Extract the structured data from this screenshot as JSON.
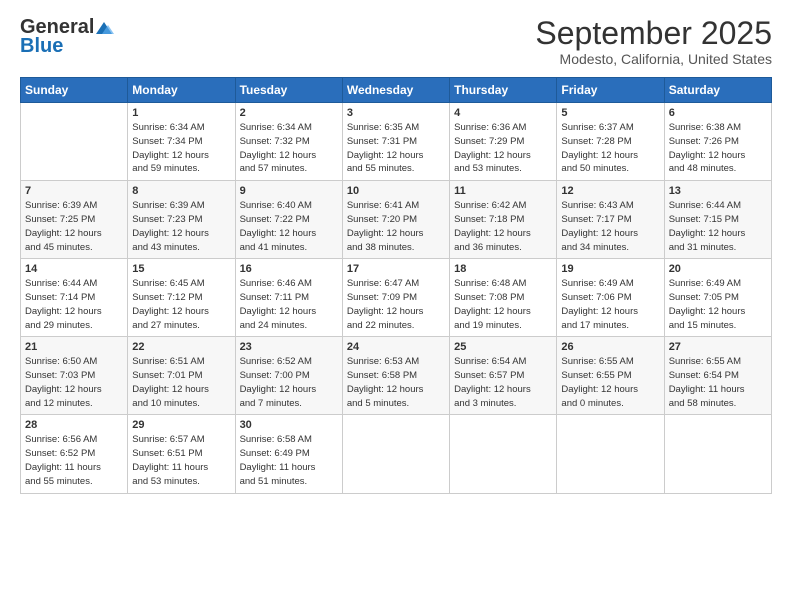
{
  "logo": {
    "general": "General",
    "blue": "Blue"
  },
  "header": {
    "title": "September 2025",
    "subtitle": "Modesto, California, United States"
  },
  "calendar": {
    "days": [
      "Sunday",
      "Monday",
      "Tuesday",
      "Wednesday",
      "Thursday",
      "Friday",
      "Saturday"
    ]
  },
  "weeks": [
    [
      {
        "day": "",
        "info": ""
      },
      {
        "day": "1",
        "info": "Sunrise: 6:34 AM\nSunset: 7:34 PM\nDaylight: 12 hours\nand 59 minutes."
      },
      {
        "day": "2",
        "info": "Sunrise: 6:34 AM\nSunset: 7:32 PM\nDaylight: 12 hours\nand 57 minutes."
      },
      {
        "day": "3",
        "info": "Sunrise: 6:35 AM\nSunset: 7:31 PM\nDaylight: 12 hours\nand 55 minutes."
      },
      {
        "day": "4",
        "info": "Sunrise: 6:36 AM\nSunset: 7:29 PM\nDaylight: 12 hours\nand 53 minutes."
      },
      {
        "day": "5",
        "info": "Sunrise: 6:37 AM\nSunset: 7:28 PM\nDaylight: 12 hours\nand 50 minutes."
      },
      {
        "day": "6",
        "info": "Sunrise: 6:38 AM\nSunset: 7:26 PM\nDaylight: 12 hours\nand 48 minutes."
      }
    ],
    [
      {
        "day": "7",
        "info": "Sunrise: 6:39 AM\nSunset: 7:25 PM\nDaylight: 12 hours\nand 45 minutes."
      },
      {
        "day": "8",
        "info": "Sunrise: 6:39 AM\nSunset: 7:23 PM\nDaylight: 12 hours\nand 43 minutes."
      },
      {
        "day": "9",
        "info": "Sunrise: 6:40 AM\nSunset: 7:22 PM\nDaylight: 12 hours\nand 41 minutes."
      },
      {
        "day": "10",
        "info": "Sunrise: 6:41 AM\nSunset: 7:20 PM\nDaylight: 12 hours\nand 38 minutes."
      },
      {
        "day": "11",
        "info": "Sunrise: 6:42 AM\nSunset: 7:18 PM\nDaylight: 12 hours\nand 36 minutes."
      },
      {
        "day": "12",
        "info": "Sunrise: 6:43 AM\nSunset: 7:17 PM\nDaylight: 12 hours\nand 34 minutes."
      },
      {
        "day": "13",
        "info": "Sunrise: 6:44 AM\nSunset: 7:15 PM\nDaylight: 12 hours\nand 31 minutes."
      }
    ],
    [
      {
        "day": "14",
        "info": "Sunrise: 6:44 AM\nSunset: 7:14 PM\nDaylight: 12 hours\nand 29 minutes."
      },
      {
        "day": "15",
        "info": "Sunrise: 6:45 AM\nSunset: 7:12 PM\nDaylight: 12 hours\nand 27 minutes."
      },
      {
        "day": "16",
        "info": "Sunrise: 6:46 AM\nSunset: 7:11 PM\nDaylight: 12 hours\nand 24 minutes."
      },
      {
        "day": "17",
        "info": "Sunrise: 6:47 AM\nSunset: 7:09 PM\nDaylight: 12 hours\nand 22 minutes."
      },
      {
        "day": "18",
        "info": "Sunrise: 6:48 AM\nSunset: 7:08 PM\nDaylight: 12 hours\nand 19 minutes."
      },
      {
        "day": "19",
        "info": "Sunrise: 6:49 AM\nSunset: 7:06 PM\nDaylight: 12 hours\nand 17 minutes."
      },
      {
        "day": "20",
        "info": "Sunrise: 6:49 AM\nSunset: 7:05 PM\nDaylight: 12 hours\nand 15 minutes."
      }
    ],
    [
      {
        "day": "21",
        "info": "Sunrise: 6:50 AM\nSunset: 7:03 PM\nDaylight: 12 hours\nand 12 minutes."
      },
      {
        "day": "22",
        "info": "Sunrise: 6:51 AM\nSunset: 7:01 PM\nDaylight: 12 hours\nand 10 minutes."
      },
      {
        "day": "23",
        "info": "Sunrise: 6:52 AM\nSunset: 7:00 PM\nDaylight: 12 hours\nand 7 minutes."
      },
      {
        "day": "24",
        "info": "Sunrise: 6:53 AM\nSunset: 6:58 PM\nDaylight: 12 hours\nand 5 minutes."
      },
      {
        "day": "25",
        "info": "Sunrise: 6:54 AM\nSunset: 6:57 PM\nDaylight: 12 hours\nand 3 minutes."
      },
      {
        "day": "26",
        "info": "Sunrise: 6:55 AM\nSunset: 6:55 PM\nDaylight: 12 hours\nand 0 minutes."
      },
      {
        "day": "27",
        "info": "Sunrise: 6:55 AM\nSunset: 6:54 PM\nDaylight: 11 hours\nand 58 minutes."
      }
    ],
    [
      {
        "day": "28",
        "info": "Sunrise: 6:56 AM\nSunset: 6:52 PM\nDaylight: 11 hours\nand 55 minutes."
      },
      {
        "day": "29",
        "info": "Sunrise: 6:57 AM\nSunset: 6:51 PM\nDaylight: 11 hours\nand 53 minutes."
      },
      {
        "day": "30",
        "info": "Sunrise: 6:58 AM\nSunset: 6:49 PM\nDaylight: 11 hours\nand 51 minutes."
      },
      {
        "day": "",
        "info": ""
      },
      {
        "day": "",
        "info": ""
      },
      {
        "day": "",
        "info": ""
      },
      {
        "day": "",
        "info": ""
      }
    ]
  ]
}
